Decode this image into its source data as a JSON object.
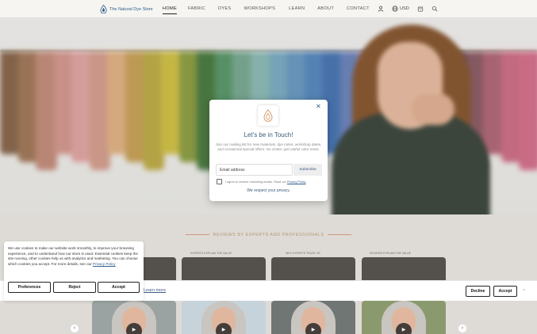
{
  "header": {
    "logo_text": "The Natural Dye Store",
    "nav": [
      "HOME",
      "FABRIC",
      "DYES",
      "WORKSHOPS",
      "LEARN",
      "ABOUT",
      "CONTACT"
    ],
    "active_nav": "HOME",
    "currency": "USD",
    "icons": [
      "account-icon",
      "globe-icon",
      "cart-icon",
      "search-icon"
    ]
  },
  "section": {
    "reviews_heading": "REVIEWS BY EXPERTS AND PROFESSIONALS",
    "card_labels": [
      "...VE QUALITY",
      "EXPERTS EXPLAIN THE VALUE",
      "WHY EXPERTS TRUST US",
      "REVIEWS EXPLAIN THE VALUE"
    ]
  },
  "popup": {
    "title": "Let's be in Touch!",
    "description": "Join our mailing list for new materials, dye notes, workshop dates, and occasional special offers. No clutter, just useful color news.",
    "email_placeholder": "Email address",
    "subscribe_label": "Subscribe",
    "consent_text": "I agree to receive marketing emails. Read our",
    "privacy_link": "Privacy Policy",
    "privacy_note": "We respect your privacy."
  },
  "cookie": {
    "text": "We use cookies to make our website work smoothly, to improve your browsing experience, and to understand how our store is used. Essential cookies keep the site running, other cookies help us with analytics and marketing. You can choose which cookies you accept. For more details, see our",
    "policy_link": "Privacy Policy",
    "preferences_label": "Preferences",
    "reject_label": "Reject",
    "accept_label": "Accept",
    "learn_more": "Learn more",
    "decline_label": "Decline",
    "accept_bar_label": "Accept"
  },
  "colors": {
    "brand_blue": "#2f5d8a",
    "accent_peach": "#d9a08a",
    "swatches": [
      "#8b6a4f",
      "#a47b5c",
      "#c58f7e",
      "#d59a91",
      "#e2a7a4",
      "#d6a090",
      "#e3b486",
      "#c9a35a",
      "#bfae49",
      "#d2c249",
      "#8fa046",
      "#4e7d44",
      "#5e9a6d",
      "#7cab94",
      "#8fbcb7",
      "#7eaec3",
      "#6c9cc2",
      "#5a8bc0",
      "#4c78b4",
      "#6f86bd",
      "#9a8fbd",
      "#b596bd",
      "#a27aa7",
      "#8a6896",
      "#7d5c7f",
      "#6b5160",
      "#8e5f68",
      "#b36a7a",
      "#cf7187",
      "#d6728d"
    ]
  }
}
